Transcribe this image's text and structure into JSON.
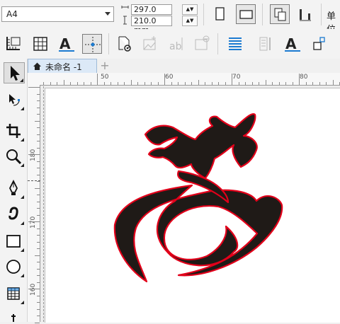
{
  "property_bar": {
    "paper_size": "A4",
    "width_value": "297.0 mm",
    "height_value": "210.0 mm",
    "units_label": "单位"
  },
  "toolbar2": {
    "icons": [
      "ruler-options-icon",
      "grid-options-icon",
      "text-options-icon",
      "guidelines-icon",
      "page-options-icon",
      "add-image-icon",
      "text-frame-icon",
      "remove-image-icon",
      "text-align-icon",
      "paragraph-icon",
      "character-format-icon",
      "transform-icon"
    ]
  },
  "tools": [
    "pick-tool-icon",
    "shape-tool-icon",
    "crop-tool-icon",
    "zoom-tool-icon",
    "freehand-tool-icon",
    "artistic-media-tool-icon",
    "rectangle-tool-icon",
    "ellipse-tool-icon",
    "table-tool-icon"
  ],
  "document": {
    "tab_title": "未命名 -1",
    "add_tab_symbol": "+"
  },
  "rulers": {
    "horizontal_labels": [
      "50",
      "60",
      "70",
      "80"
    ],
    "vertical_labels": [
      "180",
      "170",
      "160"
    ]
  },
  "artwork": {
    "fill_color": "#1f1a17",
    "outline_color": "#e2001a"
  }
}
